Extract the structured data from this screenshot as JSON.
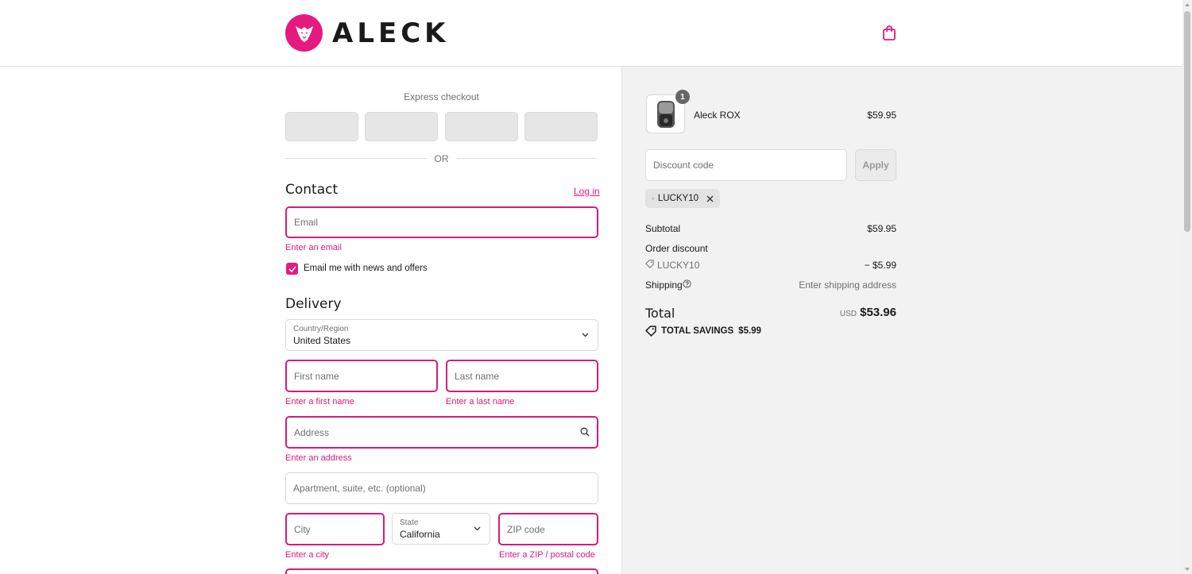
{
  "brand": {
    "name": "ALECK",
    "accent_color": "#e6197f",
    "error_color": "#d61c76"
  },
  "header": {
    "cart_icon": "shopping-bag-icon"
  },
  "express": {
    "label": "Express checkout",
    "divider": "OR"
  },
  "contact": {
    "title": "Contact",
    "login_label": "Log in",
    "email_placeholder": "Email",
    "email_error": "Enter an email",
    "newsletter_label": "Email me with news and offers",
    "newsletter_checked": true
  },
  "delivery": {
    "title": "Delivery",
    "country_label": "Country/Region",
    "country_value": "United States",
    "first_name_placeholder": "First name",
    "first_name_error": "Enter a first name",
    "last_name_placeholder": "Last name",
    "last_name_error": "Enter a last name",
    "address_placeholder": "Address",
    "address_error": "Enter an address",
    "apartment_placeholder": "Apartment, suite, etc. (optional)",
    "city_placeholder": "City",
    "city_error": "Enter a city",
    "state_label": "State",
    "state_value": "California",
    "zip_placeholder": "ZIP code",
    "zip_error": "Enter a ZIP / postal code"
  },
  "summary": {
    "item": {
      "name": "Aleck ROX",
      "price": "$59.95",
      "quantity": "1"
    },
    "discount_placeholder": "Discount code",
    "apply_label": "Apply",
    "applied_code": "LUCKY10",
    "subtotal_label": "Subtotal",
    "subtotal_value": "$59.95",
    "order_discount_label": "Order discount",
    "discount_code": "LUCKY10",
    "discount_value": "− $5.99",
    "shipping_label": "Shipping",
    "shipping_value": "Enter shipping address",
    "total_label": "Total",
    "currency": "USD",
    "total_value": "$53.96",
    "savings_label": "TOTAL SAVINGS",
    "savings_value": "$5.99"
  }
}
